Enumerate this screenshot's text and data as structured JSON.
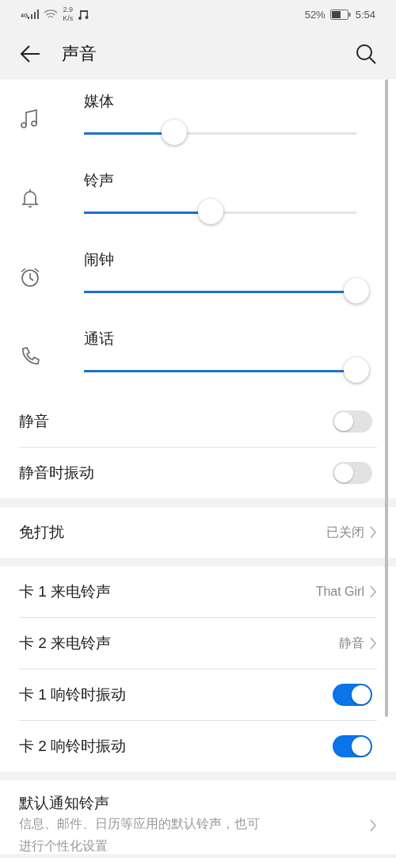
{
  "status_bar": {
    "network": "4G",
    "speed_value": "2.9",
    "speed_unit": "K/s",
    "battery": "52%",
    "time": "5:54"
  },
  "header": {
    "title": "声音"
  },
  "sections": [
    {
      "items": [
        {
          "kind": "slider",
          "label": "媒体",
          "level": 0.33
        },
        {
          "kind": "slider",
          "label": "铃声",
          "level": 0.465
        },
        {
          "kind": "slider",
          "label": "闹钟",
          "level": 1
        },
        {
          "kind": "slider",
          "label": "通话",
          "level": 1
        },
        {
          "kind": "toggle",
          "label": "静音",
          "on": false
        },
        {
          "kind": "toggle",
          "label": "静音时振动",
          "on": false
        }
      ]
    },
    {
      "items": [
        {
          "kind": "link",
          "label": "免打扰",
          "value": "已关闭"
        }
      ]
    },
    {
      "items": [
        {
          "kind": "link",
          "label": "卡 1 来电铃声",
          "value": "That Girl"
        },
        {
          "kind": "link",
          "label": "卡 2 来电铃声",
          "value": "静音"
        },
        {
          "kind": "toggle",
          "label": "卡 1 响铃时振动",
          "on": true
        },
        {
          "kind": "toggle",
          "label": "卡 2 响铃时振动",
          "on": true
        }
      ]
    },
    {
      "items": [
        {
          "kind": "detail",
          "label": "默认通知铃声",
          "description_lines": [
            "信息、邮件、日历等应用的默认铃声，也可",
            "进行个性化设置"
          ]
        }
      ]
    }
  ]
}
